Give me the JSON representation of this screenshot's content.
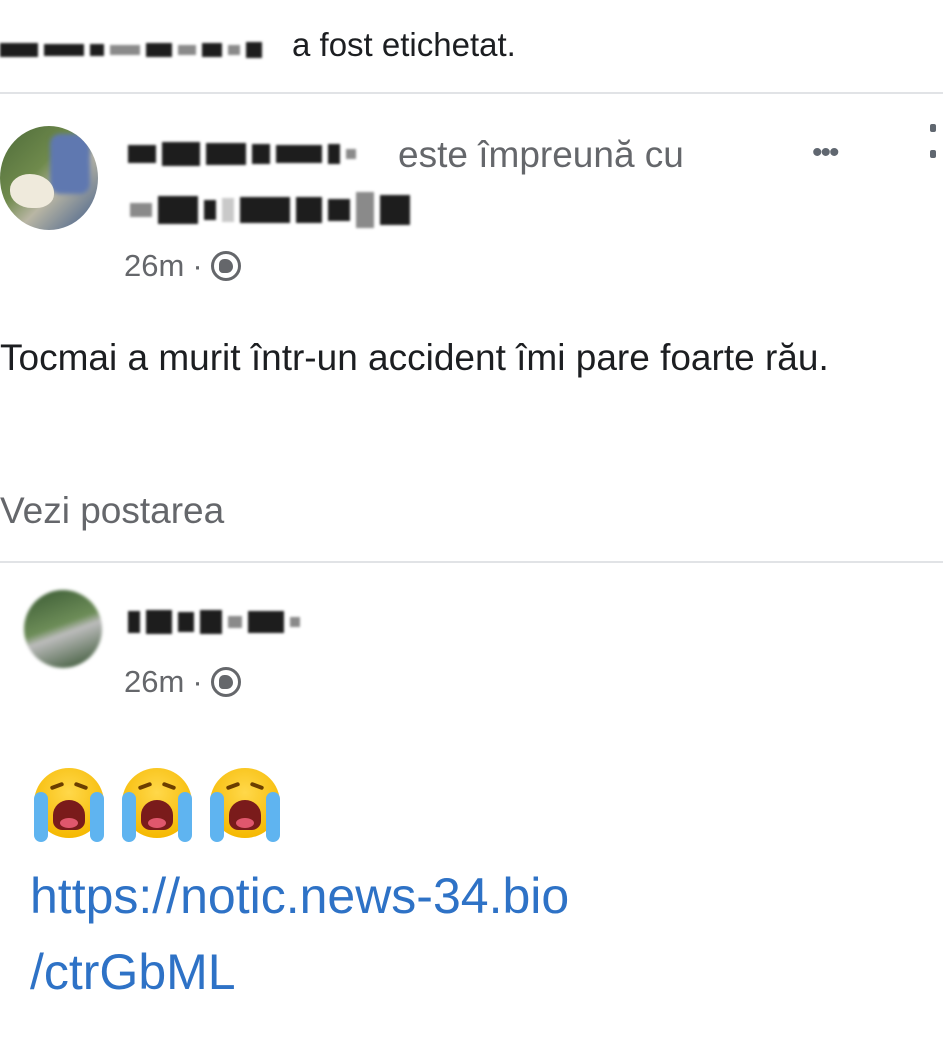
{
  "header": {
    "tagged_text": "a fost etichetat."
  },
  "post1": {
    "with_text": "este împreună cu",
    "more_icon": "more-horizontal-icon",
    "time": "26m",
    "separator": "·",
    "privacy_icon": "globe-icon",
    "body": "Tocmai a murit într-un accident îmi pare foarte rău.",
    "see_post_label": "Vezi postarea"
  },
  "post2": {
    "time": "26m",
    "separator": "·",
    "privacy_icon": "globe-icon",
    "emojis": [
      "loudly-crying-face",
      "loudly-crying-face",
      "loudly-crying-face"
    ],
    "link_line1": "https://notic.news-34.bio",
    "link_line2": "/ctrGbML"
  },
  "colors": {
    "text": "#1c1e21",
    "secondary": "#65676b",
    "link": "#2e72c6",
    "divider": "#e1e3e6"
  }
}
